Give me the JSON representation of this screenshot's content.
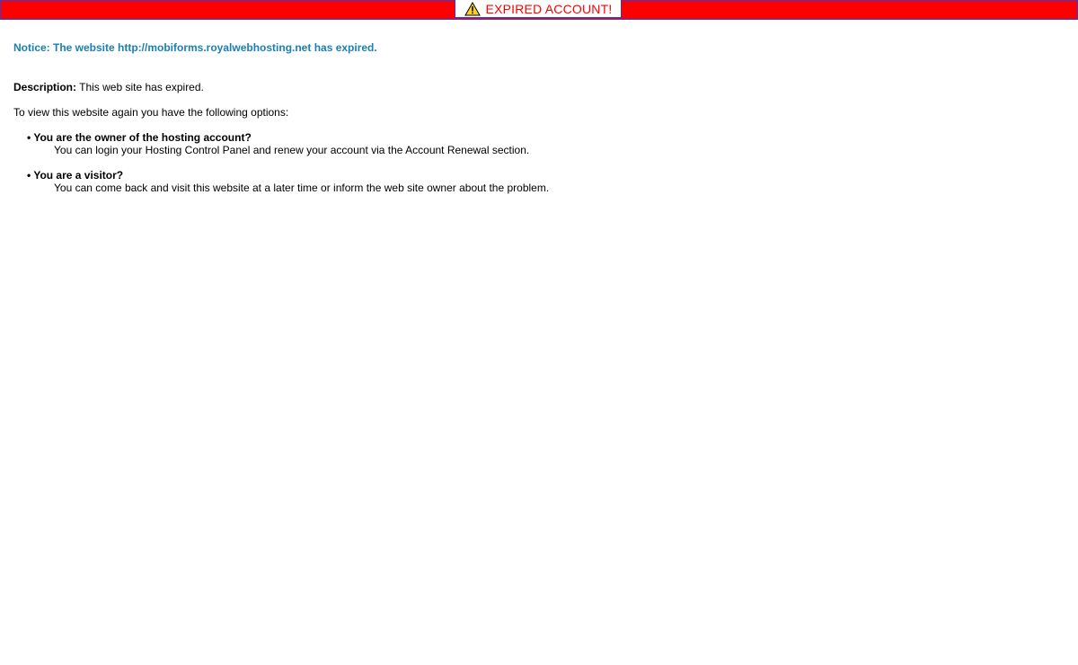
{
  "banner": {
    "text": "EXPIRED ACCOUNT!",
    "icon": "warning-triangle-icon",
    "bar_color": "#ff0000",
    "text_color": "#ff0000"
  },
  "notice": {
    "text": "Notice: The website http://mobiforms.royalwebhosting.net has expired.",
    "color": "#1a7fb5"
  },
  "description": {
    "label": "Description:",
    "text": " This web site has expired."
  },
  "intro": "To view this website again you have the following options:",
  "options": [
    {
      "bullet": "•",
      "title": "You are the owner of the hosting account?",
      "text": "You can login your Hosting Control Panel and renew your account via the Account Renewal section."
    },
    {
      "bullet": "•",
      "title": "You are a visitor?",
      "text": "You can come back and visit this website at a later time or inform the web site owner about the problem."
    }
  ]
}
